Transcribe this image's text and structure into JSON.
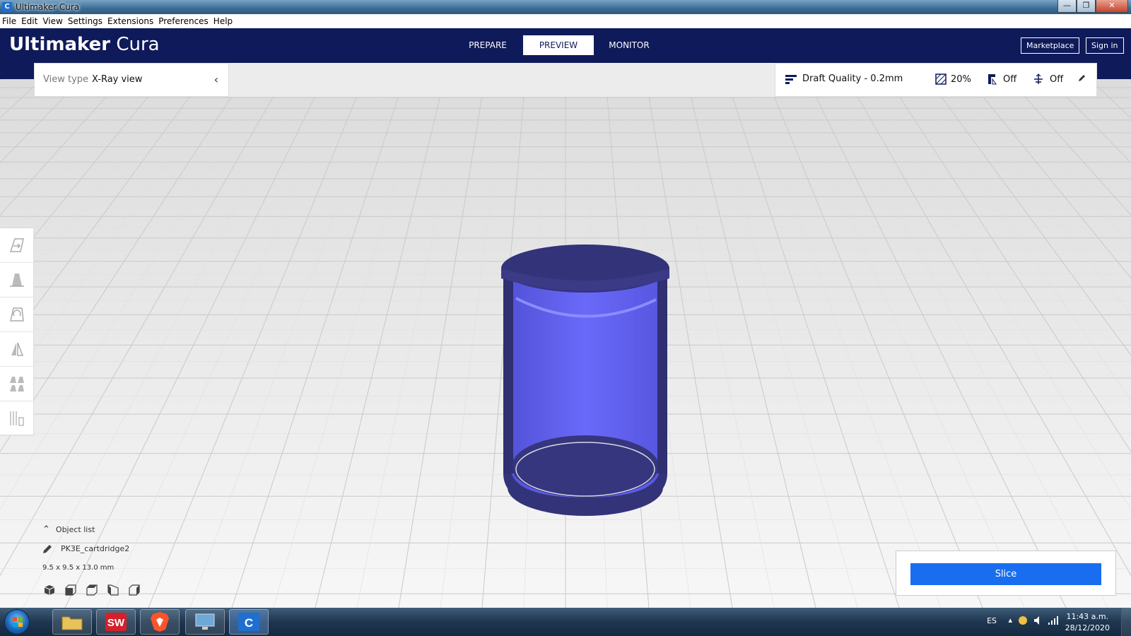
{
  "window": {
    "title": "Ultimaker Cura",
    "min_label": "—",
    "max_label": "❐",
    "close_label": "✕"
  },
  "menu": [
    "File",
    "Edit",
    "View",
    "Settings",
    "Extensions",
    "Preferences",
    "Help"
  ],
  "header": {
    "logo_bold": "Ultimaker",
    "logo_light": "Cura",
    "stages": [
      "PREPARE",
      "PREVIEW",
      "MONITOR"
    ],
    "active_stage": "PREVIEW",
    "marketplace_label": "Marketplace",
    "signin_label": "Sign in"
  },
  "view_type": {
    "label": "View type",
    "value": "X-Ray view"
  },
  "print_settings": {
    "profile": "Draft Quality - 0.2mm",
    "infill": "20%",
    "support": "Off",
    "adhesion": "Off"
  },
  "object_list": {
    "header": "Object list",
    "object_name": "PK3E_cartdridge2",
    "dimensions": "9.5 x 9.5 x 13.0 mm"
  },
  "slice": {
    "label": "Slice"
  },
  "taskbar": {
    "apps": [
      "explorer",
      "solidworks",
      "brave",
      "control-panel",
      "cura"
    ],
    "language": "ES",
    "time": "11:43 a.m.",
    "date": "28/12/2020"
  },
  "colors": {
    "header_bg": "#0f1a5a",
    "slice_blue": "#196ef0",
    "model_dark": "#33337a",
    "model_light": "#6868f8"
  }
}
